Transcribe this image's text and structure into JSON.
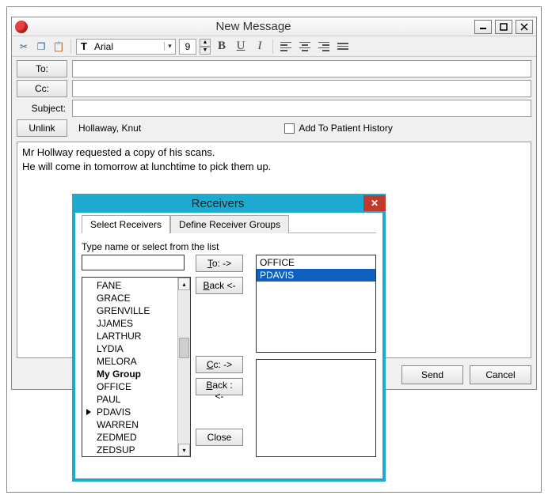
{
  "window": {
    "title": "New Message"
  },
  "toolbar": {
    "font_name": "Arial",
    "font_size": "9"
  },
  "labels": {
    "to": "To:",
    "cc": "Cc:",
    "subject": "Subject:",
    "unlink": "Unlink",
    "add_history": "Add To Patient History",
    "send": "Send",
    "cancel": "Cancel"
  },
  "fields": {
    "to": "",
    "cc": "",
    "subject": "",
    "patient": "Hollaway, Knut"
  },
  "body": {
    "line1": "Mr Hollway requested a copy of his scans.",
    "line2": "He will come in tomorrow at lunchtime to pick them up."
  },
  "receivers": {
    "title": "Receivers",
    "tab1": "Select Receivers",
    "tab2": "Define Receiver Groups",
    "search_label": "Type name or select from the list",
    "to_btn": "o: ->",
    "to_btn_prefix": "T",
    "back_btn": "ack <-",
    "back_btn_prefix": "B",
    "cc_btn": "c: ->",
    "cc_btn_prefix": "C",
    "back2_btn": "ack : <-",
    "back2_btn_prefix": "B",
    "close_btn": "Close",
    "names": [
      {
        "label": "FANE"
      },
      {
        "label": "GRACE"
      },
      {
        "label": "GRENVILLE"
      },
      {
        "label": "JJAMES"
      },
      {
        "label": "LARTHUR"
      },
      {
        "label": "LYDIA"
      },
      {
        "label": "MELORA"
      },
      {
        "label": "My Group",
        "bold": true
      },
      {
        "label": "OFFICE"
      },
      {
        "label": "PAUL"
      },
      {
        "label": "PDAVIS",
        "marked": true
      },
      {
        "label": "WARREN"
      },
      {
        "label": "ZEDMED"
      },
      {
        "label": "ZEDSUP"
      }
    ],
    "to_list": [
      {
        "label": "OFFICE",
        "selected": false
      },
      {
        "label": "PDAVIS",
        "selected": true
      }
    ],
    "cc_list": []
  }
}
